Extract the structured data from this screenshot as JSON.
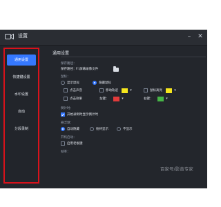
{
  "window": {
    "title": "设置",
    "icon": "camera-icon"
  },
  "sidebar": {
    "items": [
      {
        "label": "通用设置",
        "active": true
      },
      {
        "label": "快捷键设置",
        "active": false
      },
      {
        "label": "水印设置",
        "active": false
      },
      {
        "label": "自动",
        "active": false
      },
      {
        "label": "分段录制",
        "active": false
      }
    ]
  },
  "general": {
    "tab_label": "通用设置",
    "save_label": "保存路径：",
    "save_path": "F:\\屏幕录像文件",
    "mouse_label": "鼠标：",
    "show_mouse": "显示鼠标",
    "hide_mouse": "隐藏鼠标",
    "click_sound": "点击声音",
    "move_track": "移动轨迹",
    "cursor_highlight": "鼠标高亮",
    "click_effect": "点击效果",
    "left_key": "左键：",
    "right_key": "右键：",
    "countdown_label": "倒计时：",
    "countdown_option": "开始录制时显示倒计时",
    "float_label": "悬浮球：",
    "auto_hide": "自动隐藏",
    "always_show": "始终显示",
    "no_show": "不显示",
    "startup_label": "开机启动：",
    "startup_option": "启用老板键",
    "bottom_label": "帧率："
  },
  "colors": {
    "accent": "#3578ff",
    "highlight_yellow": "#f6e61d",
    "left_key_red": "#e23b3b",
    "right_key_green": "#47b547",
    "annotation_red": "#d9121b"
  },
  "watermark": "百家号/影音专家"
}
